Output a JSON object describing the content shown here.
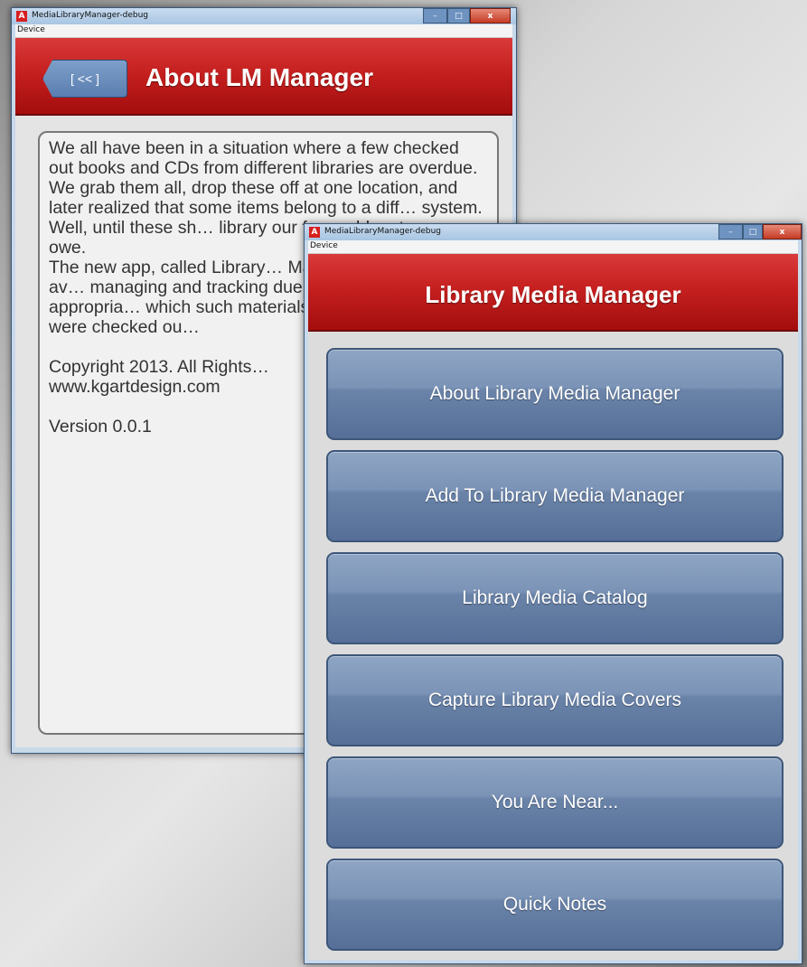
{
  "about_window": {
    "title": "MediaLibraryManager-debug",
    "app_icon": "A",
    "menu": "Device",
    "back_label": "[ << ]",
    "header_title": "About LM Manager",
    "paragraph1": "We all have been in a situation where a few checked out books and CDs from different libraries are overdue. We grab them all, drop these off at one location, and later realized that some items belong to a diff… system. Well, until these sh… library our fees add up to a… we owe.",
    "paragraph2": "The new app, called Library… Manager, will help users av… managing and tracking due… returning items to appropria… which such materials as Bo… VHS, etc., were checked ou…",
    "copyright": "Copyright 2013. All Rights…",
    "website": "www.kgartdesign.com",
    "version": "Version 0.0.1",
    "min_glyph": "–",
    "max_glyph": "□",
    "close_glyph": "x"
  },
  "main_window": {
    "title": "MediaLibraryManager-debug",
    "app_icon": "A",
    "menu": "Device",
    "header_title": "Library Media Manager",
    "min_glyph": "–",
    "max_glyph": "□",
    "close_glyph": "x",
    "buttons": [
      "About Library Media Manager",
      "Add To Library Media Manager",
      "Library Media Catalog",
      "Capture Library Media Covers",
      "You Are Near...",
      "Quick Notes"
    ]
  },
  "colors": {
    "header_red": "#c62020",
    "button_blue": "#6a83a8",
    "frame_blue": "#c8d9ea"
  }
}
